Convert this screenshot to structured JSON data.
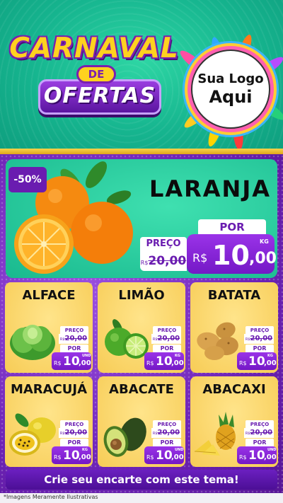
{
  "header": {
    "title_line1": "CARNAVAL",
    "title_connector": "DE",
    "title_line2": "OFERTAS",
    "logo_line1": "Sua Logo",
    "logo_line2": "Aqui"
  },
  "featured": {
    "discount": "-50%",
    "name": "LARANJA",
    "price_label": "PREÇO",
    "old_currency": "R$",
    "old_price": "20,00",
    "por_label": "POR",
    "currency": "R$",
    "price_int": "10",
    "price_cents": ",00",
    "unit": "KG"
  },
  "products": [
    {
      "name": "ALFACE",
      "price_label": "PREÇO",
      "old_currency": "R$",
      "old_price": "20,00",
      "por_label": "POR",
      "currency": "R$",
      "price_int": "10",
      "price_cents": ",00",
      "unit": "UND"
    },
    {
      "name": "LIMÃO",
      "price_label": "PREÇO",
      "old_currency": "R$",
      "old_price": "20,00",
      "por_label": "POR",
      "currency": "R$",
      "price_int": "10",
      "price_cents": ",00",
      "unit": "KG"
    },
    {
      "name": "BATATA",
      "price_label": "PREÇO",
      "old_currency": "R$",
      "old_price": "20,00",
      "por_label": "POR",
      "currency": "R$",
      "price_int": "10",
      "price_cents": ",00",
      "unit": "KG"
    },
    {
      "name": "MARACUJÁ",
      "price_label": "PREÇO",
      "old_currency": "R$",
      "old_price": "20,00",
      "por_label": "POR",
      "currency": "R$",
      "price_int": "10",
      "price_cents": ",00",
      "unit": "KG"
    },
    {
      "name": "ABACATE",
      "price_label": "PREÇO",
      "old_currency": "R$",
      "old_price": "20,00",
      "por_label": "POR",
      "currency": "R$",
      "price_int": "10",
      "price_cents": ",00",
      "unit": "UND"
    },
    {
      "name": "ABACAXI",
      "price_label": "PREÇO",
      "old_currency": "R$",
      "old_price": "20,00",
      "por_label": "POR",
      "currency": "R$",
      "price_int": "10",
      "price_cents": ",00",
      "unit": "UND"
    }
  ],
  "footer": {
    "cta": "Crie seu encarte com este tema!",
    "disclaimer": "*Imagens Meramente Ilustrativas"
  },
  "colors": {
    "header_teal": "#16b58f",
    "purple": "#7418c6",
    "card_yellow": "#f7cc56",
    "feature_green": "#19b98e"
  }
}
